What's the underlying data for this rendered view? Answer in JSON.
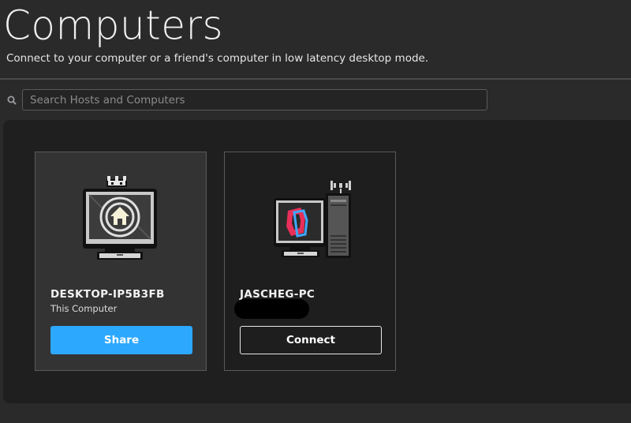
{
  "header": {
    "title": "Computers",
    "subtitle": "Connect to your computer or a friend's computer in low latency desktop mode."
  },
  "search": {
    "placeholder": "Search Hosts and Computers",
    "icon": "search-icon"
  },
  "computers": [
    {
      "name": "DESKTOP-IP5B3FB",
      "status": "This Computer",
      "button_label": "Share",
      "icon": "home-monitor-icon",
      "badge_icon": "crown-icon",
      "button_color": "#2da8ff"
    },
    {
      "name": "JASCHEG-PC",
      "status": "",
      "status_redacted": true,
      "button_label": "Connect",
      "icon": "parsec-pc-icon",
      "badge_icon": "signal-icon"
    }
  ]
}
